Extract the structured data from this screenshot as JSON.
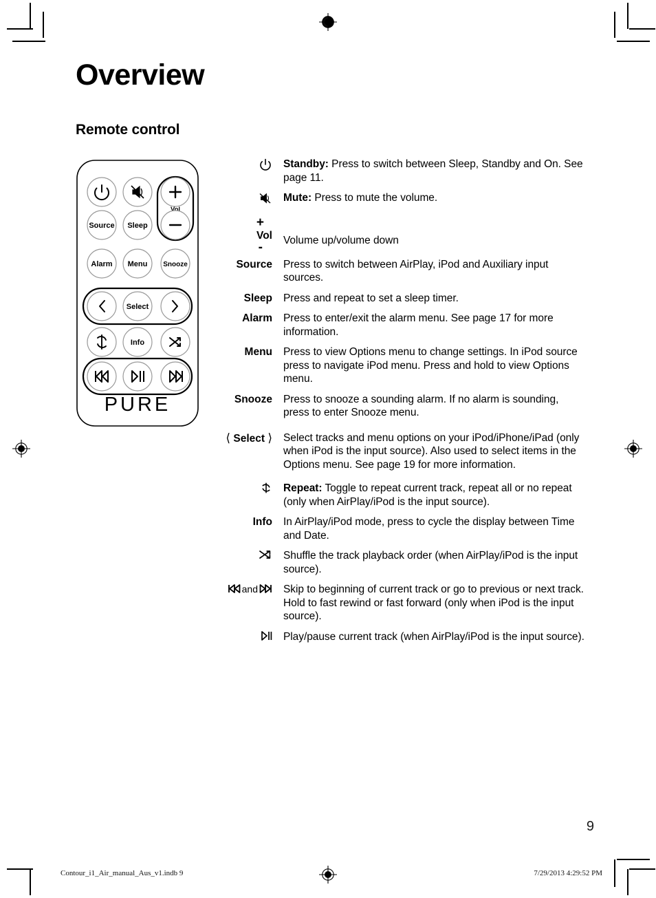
{
  "page": {
    "title": "Overview",
    "subtitle": "Remote control",
    "number": "9"
  },
  "footer": {
    "file": "Contour_i1_Air_manual_Aus_v1.indb   9",
    "timestamp": "7/29/2013   4:29:52 PM"
  },
  "remote": {
    "brand": "PURE",
    "buttons": [
      {
        "id": "standby",
        "label": "",
        "icon": "power-icon"
      },
      {
        "id": "mute",
        "label": "",
        "icon": "mute-icon"
      },
      {
        "id": "vol-up",
        "label": "+",
        "icon": "plus-icon"
      },
      {
        "id": "vol-label",
        "label": "Vol",
        "icon": ""
      },
      {
        "id": "vol-down",
        "label": "—",
        "icon": "minus-icon"
      },
      {
        "id": "source",
        "label": "Source",
        "icon": ""
      },
      {
        "id": "sleep",
        "label": "Sleep",
        "icon": ""
      },
      {
        "id": "alarm",
        "label": "Alarm",
        "icon": ""
      },
      {
        "id": "menu",
        "label": "Menu",
        "icon": ""
      },
      {
        "id": "snooze",
        "label": "Snooze",
        "icon": ""
      },
      {
        "id": "left",
        "label": "",
        "icon": "chevron-left-icon"
      },
      {
        "id": "select",
        "label": "Select",
        "icon": ""
      },
      {
        "id": "right",
        "label": "",
        "icon": "chevron-right-icon"
      },
      {
        "id": "repeat",
        "label": "",
        "icon": "repeat-icon"
      },
      {
        "id": "info",
        "label": "Info",
        "icon": ""
      },
      {
        "id": "shuffle",
        "label": "",
        "icon": "shuffle-icon"
      },
      {
        "id": "previous",
        "label": "",
        "icon": "skip-back-icon"
      },
      {
        "id": "playpause",
        "label": "",
        "icon": "play-pause-icon"
      },
      {
        "id": "next",
        "label": "",
        "icon": "skip-forward-icon"
      }
    ]
  },
  "descriptions": [
    {
      "key_type": "icon",
      "key_icon": "power-icon",
      "key_label": "",
      "bold_lead": "Standby:",
      "text": " Press to switch between Sleep, Standby and On. See page 11."
    },
    {
      "key_type": "icon",
      "key_icon": "mute-icon",
      "key_label": "",
      "bold_lead": "Mute:",
      "text": " Press to mute the volume."
    },
    {
      "key_type": "vol",
      "key_plus": "+",
      "key_label": "Vol",
      "key_minus": "-",
      "bold_lead": "",
      "text": "Volume up/volume down"
    },
    {
      "key_type": "text",
      "key_label": "Source",
      "bold_lead": "",
      "text": "Press to switch between AirPlay, iPod and Auxiliary input sources."
    },
    {
      "key_type": "text",
      "key_label": "Sleep",
      "bold_lead": "",
      "text": "Press and repeat to set a sleep timer."
    },
    {
      "key_type": "text",
      "key_label": "Alarm",
      "bold_lead": "",
      "text": "Press to enter/exit the alarm menu. See page 17 for more information."
    },
    {
      "key_type": "text",
      "key_label": "Menu",
      "bold_lead": "",
      "text": "Press to view Options menu to change settings. In iPod source press to navigate iPod menu. Press and hold to view Options menu."
    },
    {
      "key_type": "text",
      "key_label": "Snooze",
      "bold_lead": "",
      "text": "Press to snooze a sounding alarm. If no alarm is sounding, press to enter Snooze menu."
    },
    {
      "key_type": "select",
      "key_label": "Select",
      "bold_lead": "",
      "text": "Select tracks and menu options on your iPod/iPhone/iPad (only when iPod is the input source). Also used to select items in the Options menu. See page 19 for more information."
    },
    {
      "key_type": "icon",
      "key_icon": "repeat-icon",
      "key_label": "",
      "bold_lead": "Repeat:",
      "text": " Toggle to repeat current track, repeat all or no repeat (only when AirPlay/iPod is the input source)."
    },
    {
      "key_type": "text",
      "key_label": "Info",
      "bold_lead": "",
      "text": "In AirPlay/iPod mode, press to cycle the display between Time and Date."
    },
    {
      "key_type": "icon",
      "key_icon": "shuffle-icon",
      "key_label": "",
      "bold_lead": "",
      "text": "Shuffle the track playback order (when AirPlay/iPod is the input source)."
    },
    {
      "key_type": "skip",
      "key_label": "and",
      "bold_lead": "",
      "text": "Skip to beginning of current track or go to previous or next track. Hold to fast rewind or fast forward (only when iPod is the input source)."
    },
    {
      "key_type": "icon",
      "key_icon": "play-pause-icon",
      "key_label": "",
      "bold_lead": "",
      "text": "Play/pause current track (when AirPlay/iPod is the input source)."
    }
  ]
}
